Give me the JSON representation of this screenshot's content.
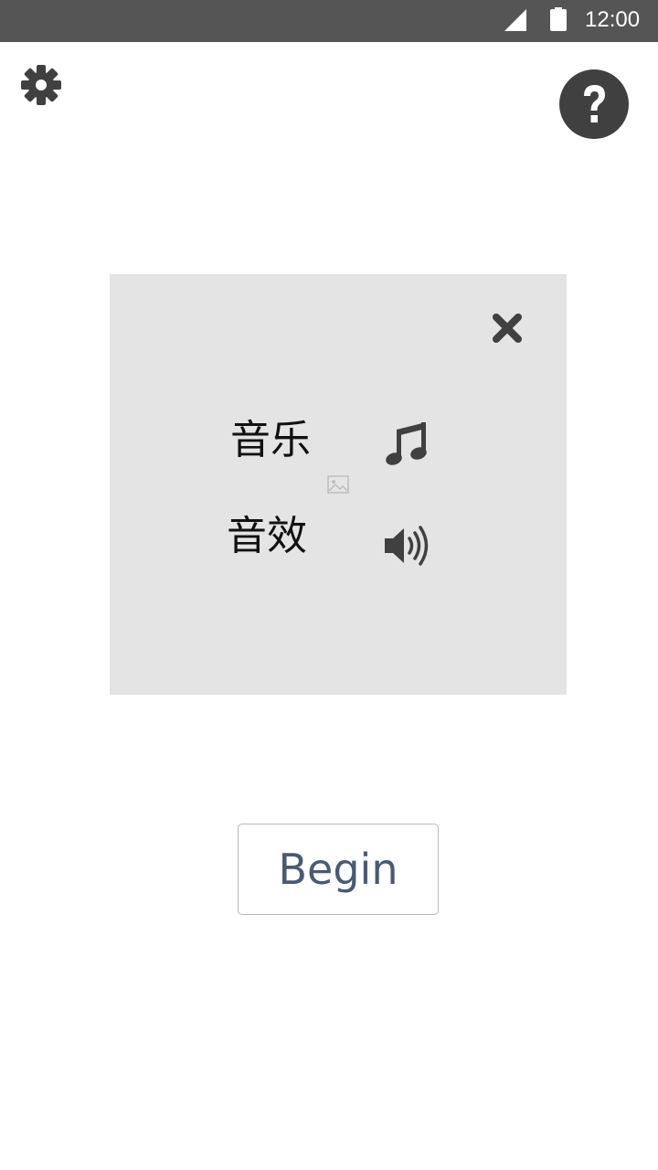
{
  "status_bar": {
    "time": "12:00",
    "icons": [
      "signal-icon",
      "battery-icon"
    ]
  },
  "toolbar": {
    "settings_icon": "gear-icon",
    "help_icon": "question-circle-icon"
  },
  "sound_dialog": {
    "close_icon": "close-icon",
    "options": [
      {
        "label": "音乐",
        "icon": "music-note-icon"
      },
      {
        "label": "音效",
        "icon": "speaker-icon"
      }
    ],
    "placeholder_icon": "broken-image-icon"
  },
  "begin_button": {
    "label": "Begin"
  },
  "colors": {
    "status_bar": "#555555",
    "dialog_bg": "#e4e4e4",
    "icon": "#404040",
    "button_text": "#4a5a72"
  }
}
